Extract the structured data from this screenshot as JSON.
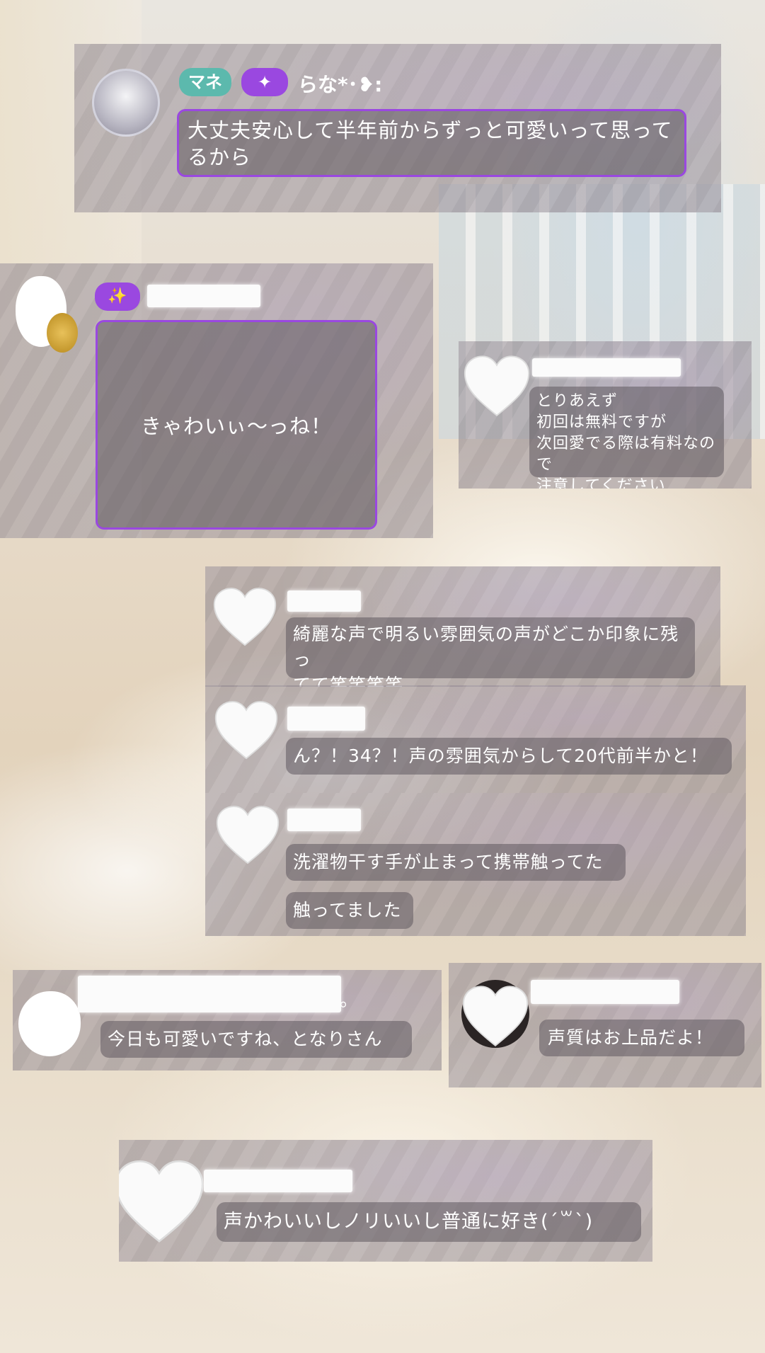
{
  "posts": [
    {
      "badge1": "マネ",
      "badge2": "✦",
      "username": "らな*･❥:",
      "message": "大丈夫安心して半年前からずっと可愛いって思ってるから"
    },
    {
      "badge": "✨",
      "message": "きゃわいぃ〜っね！"
    },
    {
      "lines": [
        "とりあえず",
        "初回は無料ですが",
        "次回愛でる際は有料なので",
        "注意してください"
      ]
    },
    {
      "message": "綺麗な声で明るい雰囲気の声がどこか印象に残っ",
      "message_line2": "てて笑笑笑笑"
    },
    {
      "message": "ん？！34？！声の雰囲気からして20代前半かと！"
    },
    {
      "message": "洗濯物干す手が止まって携帯触ってた",
      "reply": "触ってました"
    },
    {
      "name_suffix": "。",
      "message": "今日も可愛いですね、となりさん"
    },
    {
      "message": "声質はお上品だよ！"
    },
    {
      "message": "声かわいいしノリいいし普通に好き(´꒳`)"
    }
  ],
  "colors": {
    "accent_purple": "#9a48e0",
    "teal_badge": "#5cb9ad"
  }
}
